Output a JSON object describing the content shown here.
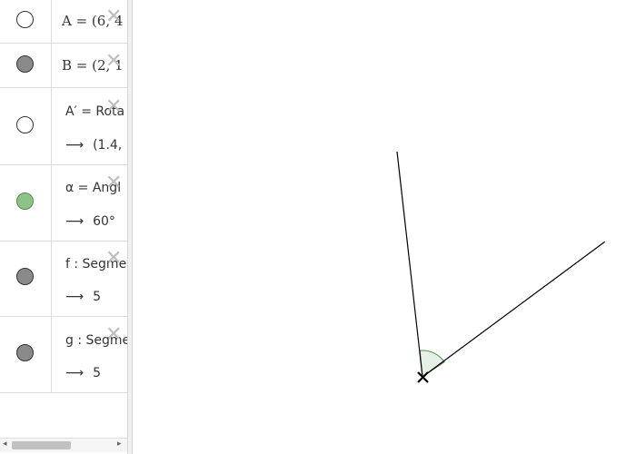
{
  "algebra": {
    "rows": [
      {
        "name": "row-A",
        "definition": "A = (6, 4",
        "value": null,
        "marble": "off"
      },
      {
        "name": "row-B",
        "definition": "B = (2, 1",
        "value": null,
        "marble": "on"
      },
      {
        "name": "row-Aprime",
        "definition": "A′ = Rota",
        "value": "(1.4,",
        "marble": "off"
      },
      {
        "name": "row-alpha",
        "definition": "α = Angl",
        "value": "60°",
        "marble": "green"
      },
      {
        "name": "row-f",
        "definition": "f : Segme",
        "value": "5",
        "marble": "on"
      },
      {
        "name": "row-g",
        "definition": "g : Segme",
        "value": "5",
        "marble": "on"
      }
    ],
    "arrow_symbol": "⟶",
    "delete_symbol": "✕"
  },
  "scrollbar": {
    "left_arrow": "◂",
    "right_arrow": "▸"
  },
  "colors": {
    "angle_fill": "#e6f0e6",
    "angle_stroke": "#4f8a4c",
    "segment": "#000000"
  }
}
